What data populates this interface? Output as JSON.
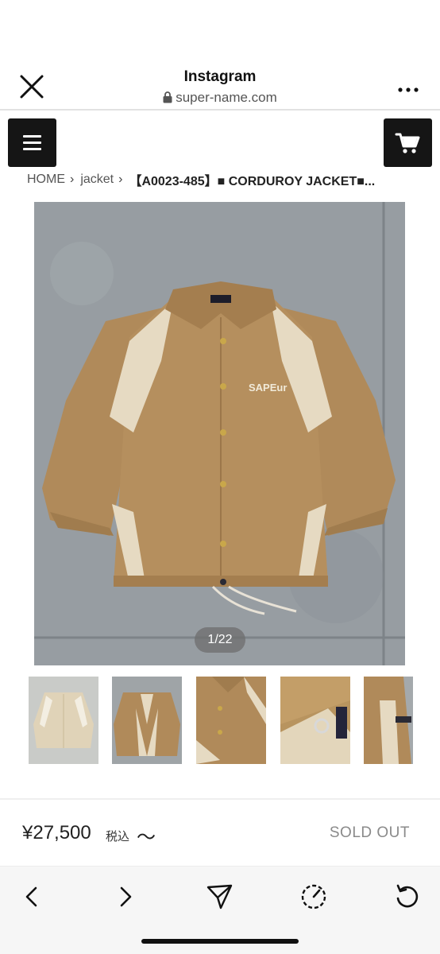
{
  "browser": {
    "title": "Instagram",
    "url": "super-name.com",
    "icons": {
      "close": "close-icon",
      "lock": "lock-icon",
      "more": "more-icon"
    }
  },
  "site_header": {
    "menu_icon": "hamburger-menu-icon",
    "cart_icon": "cart-icon"
  },
  "breadcrumb": {
    "items": [
      "HOME",
      "jacket"
    ],
    "current": "【A0023-485】■ CORDUROY JACKET■..."
  },
  "gallery": {
    "counter": "1/22",
    "jacket_brand_text": "SAPEur"
  },
  "product": {
    "price": "¥27,500",
    "tax_label": "税込",
    "tilde": "〜",
    "status": "SOLD OUT"
  },
  "toolbar": {
    "icons": [
      "back-icon",
      "forward-icon",
      "share-icon",
      "compass-icon",
      "reload-icon"
    ]
  },
  "colors": {
    "dark_button": "#151515",
    "jacket_tan": "#b08a5a",
    "jacket_cream": "#e8dcc4",
    "soldout_gray": "#8a8a8a"
  }
}
